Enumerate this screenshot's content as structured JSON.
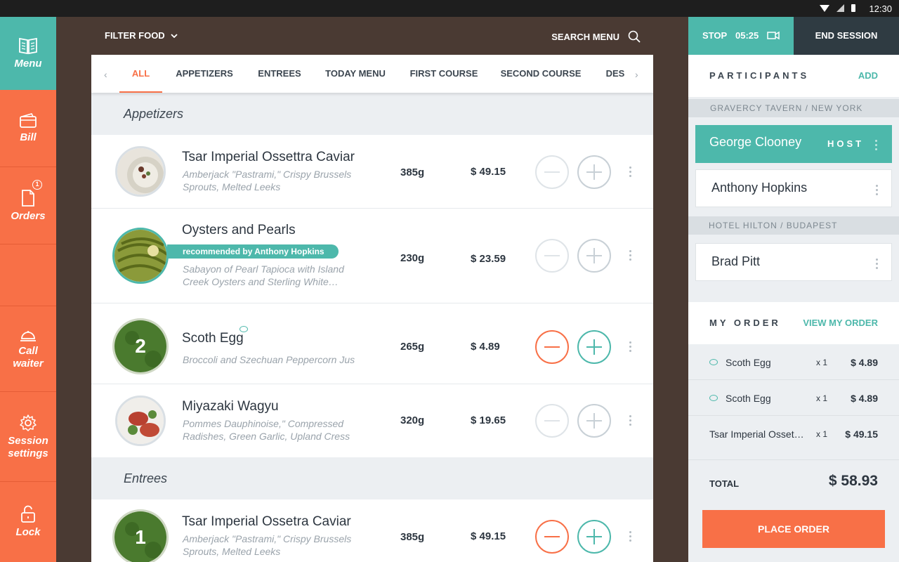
{
  "status_bar": {
    "time": "12:30"
  },
  "sidebar": {
    "items": [
      {
        "label": "Menu",
        "icon": "book-icon"
      },
      {
        "label": "Bill",
        "icon": "wallet-icon"
      },
      {
        "label": "Orders",
        "icon": "document-icon",
        "badge": "1"
      },
      {
        "label": "",
        "icon": ""
      },
      {
        "label": "Call\nwaiter",
        "icon": "cloche-icon"
      },
      {
        "label": "Session\nsettings",
        "icon": "gear-icon"
      },
      {
        "label": "Lock",
        "icon": "lock-icon"
      }
    ]
  },
  "topbar": {
    "filter_label": "FILTER FOOD",
    "search_label": "SEARCH MENU"
  },
  "tabs": [
    "ALL",
    "APPETIZERS",
    "ENTREES",
    "TODAY MENU",
    "FIRST COURSE",
    "SECOND COURSE",
    "DES"
  ],
  "sections": {
    "appetizers": "Appetizers",
    "entrees": "Entrees"
  },
  "dishes": [
    {
      "name": "Tsar Imperial Ossettra Caviar",
      "desc": "Amberjack \"Pastrami,\" Crispy Brussels Sprouts, Melted Leeks",
      "weight": "385g",
      "price": "$ 49.15"
    },
    {
      "name": "Oysters and Pearls",
      "recommended": "recommended by Anthony Hopkins",
      "desc": "Sabayon of Pearl Tapioca with Island Creek Oysters and Sterling White…",
      "weight": "230g",
      "price": "$ 23.59"
    },
    {
      "name": "Scoth Egg",
      "count": "2",
      "desc": "Broccoli and Szechuan Peppercorn Jus",
      "weight": "265g",
      "price": "$ 4.89"
    },
    {
      "name": "Miyazaki Wagyu",
      "desc": "Pommes Dauphinoise,\" Compressed Radishes, Green Garlic, Upland Cress",
      "weight": "320g",
      "price": "$ 19.65"
    },
    {
      "name": "Tsar Imperial Ossetra Caviar",
      "count": "1",
      "desc": "Amberjack \"Pastrami,\" Crispy Brussels Sprouts, Melted Leeks",
      "weight": "385g",
      "price": "$ 49.15"
    }
  ],
  "session": {
    "stop_label": "STOP",
    "timer": "05:25",
    "end_label": "END SESSION"
  },
  "participants": {
    "title": "PARTICIPANTS",
    "add_label": "ADD",
    "groups": [
      {
        "location": "GRAVERCY TAVERN / NEW YORK",
        "people": [
          {
            "name": "George Clooney",
            "role": "HOST"
          },
          {
            "name": "Anthony Hopkins"
          }
        ]
      },
      {
        "location": "HOTEL HILTON / BUDAPEST",
        "people": [
          {
            "name": "Brad Pitt"
          }
        ]
      }
    ]
  },
  "my_order": {
    "title": "MY ORDER",
    "view_label": "VIEW MY ORDER",
    "items": [
      {
        "name": "Scoth Egg",
        "qty": "x 1",
        "price": "$ 4.89"
      },
      {
        "name": "Scoth Egg",
        "qty": "x 1",
        "price": "$ 4.89"
      },
      {
        "name": "Tsar Imperial Osset…",
        "qty": "x 1",
        "price": "$ 49.15"
      }
    ],
    "total_label": "TOTAL",
    "total_value": "$ 58.93",
    "place_label": "PLACE ORDER"
  },
  "colors": {
    "accent_teal": "#4db8ab",
    "accent_orange": "#f87047",
    "dark": "#2f3b42",
    "background_brown": "#4a3a33"
  }
}
